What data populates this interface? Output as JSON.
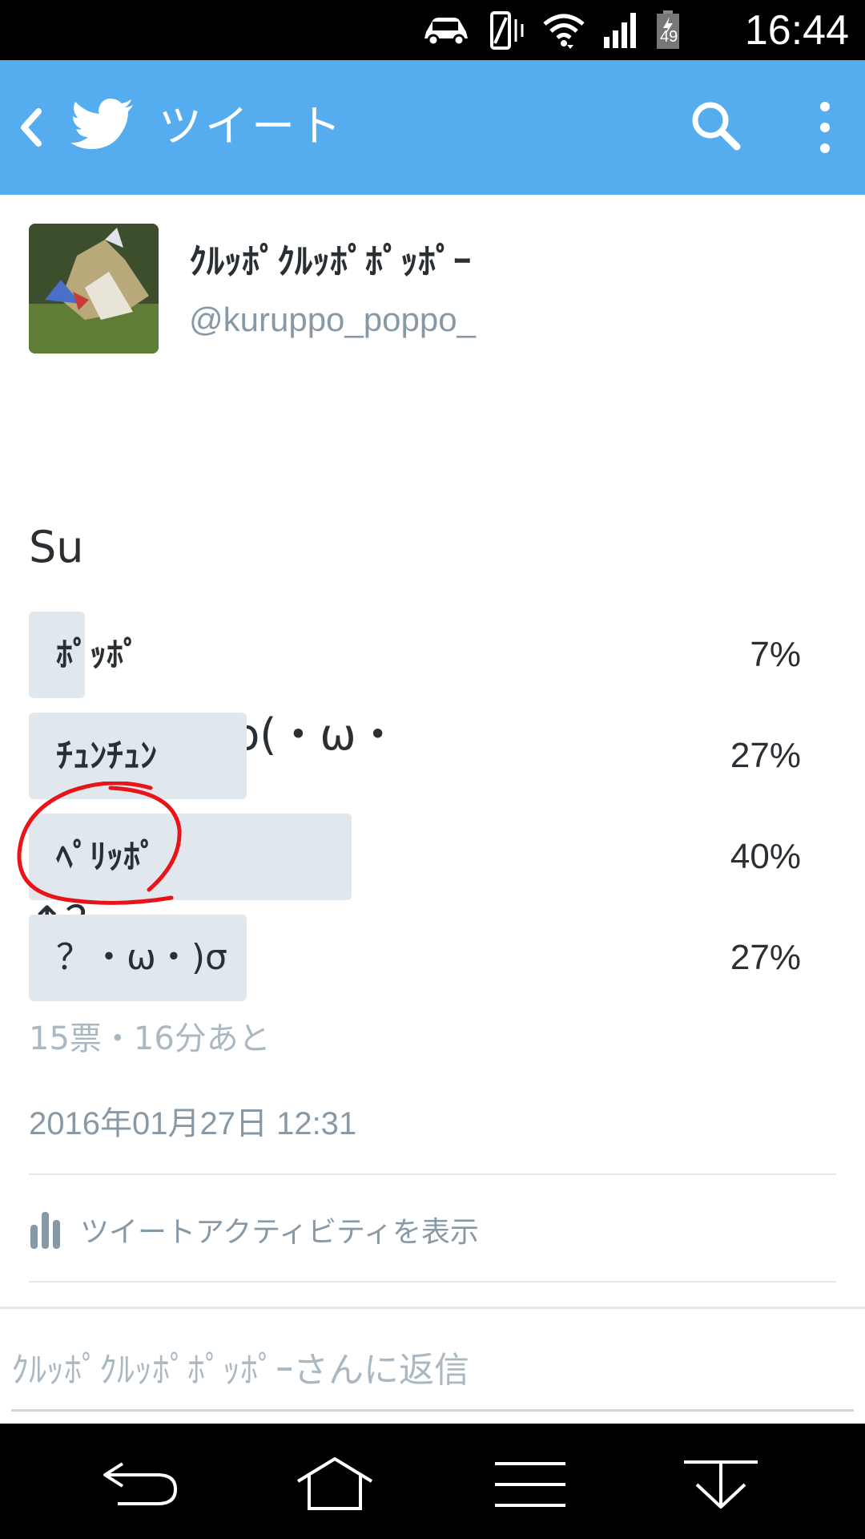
{
  "status_bar": {
    "time": "16:44",
    "battery_level": "49",
    "icons": [
      "car-icon",
      "vibrate-icon",
      "wifi-icon",
      "signal-icon",
      "battery-icon"
    ]
  },
  "app_bar": {
    "title": "ツイート",
    "icons": [
      "back-icon",
      "twitter-bird-icon",
      "search-icon",
      "overflow-menu-icon"
    ],
    "color": "#55acee"
  },
  "tweet": {
    "display_name": "ｸﾙｯﾎﾟｸﾙｯﾎﾟﾎﾟｯﾎﾟｰ",
    "handle": "@kuruppo_poppo_",
    "text_lines": [
      "Su",
      "˙:˙)　　ヽo(・ω・",
      "↑？"
    ],
    "poll": {
      "options": [
        {
          "label": "ﾎﾟｯﾎﾟ",
          "percent": "7%",
          "fraction": 0.07
        },
        {
          "label": "ﾁｭﾝﾁｭﾝ",
          "percent": "27%",
          "fraction": 0.27
        },
        {
          "label": "ﾍﾟﾘｯﾎﾟ",
          "percent": "40%",
          "fraction": 0.4
        },
        {
          "label": "？・ω・)σ",
          "percent": "27%",
          "fraction": 0.27
        }
      ],
      "meta": "15票・16分あと"
    },
    "timestamp": "2016年01月27日 12:31",
    "activity_label": "ツイートアクティビティを表示"
  },
  "reply": {
    "placeholder": "ｸﾙｯﾎﾟｸﾙｯﾎﾟﾎﾟｯﾎﾟｰさんに返信"
  },
  "nav_bar": {
    "icons": [
      "nav-back-icon",
      "nav-home-icon",
      "nav-menu-icon",
      "nav-notifications-icon"
    ]
  },
  "colors": {
    "accent": "#55acee",
    "poll_fill": "#e1e8ed",
    "annotation": "#e8141a"
  }
}
